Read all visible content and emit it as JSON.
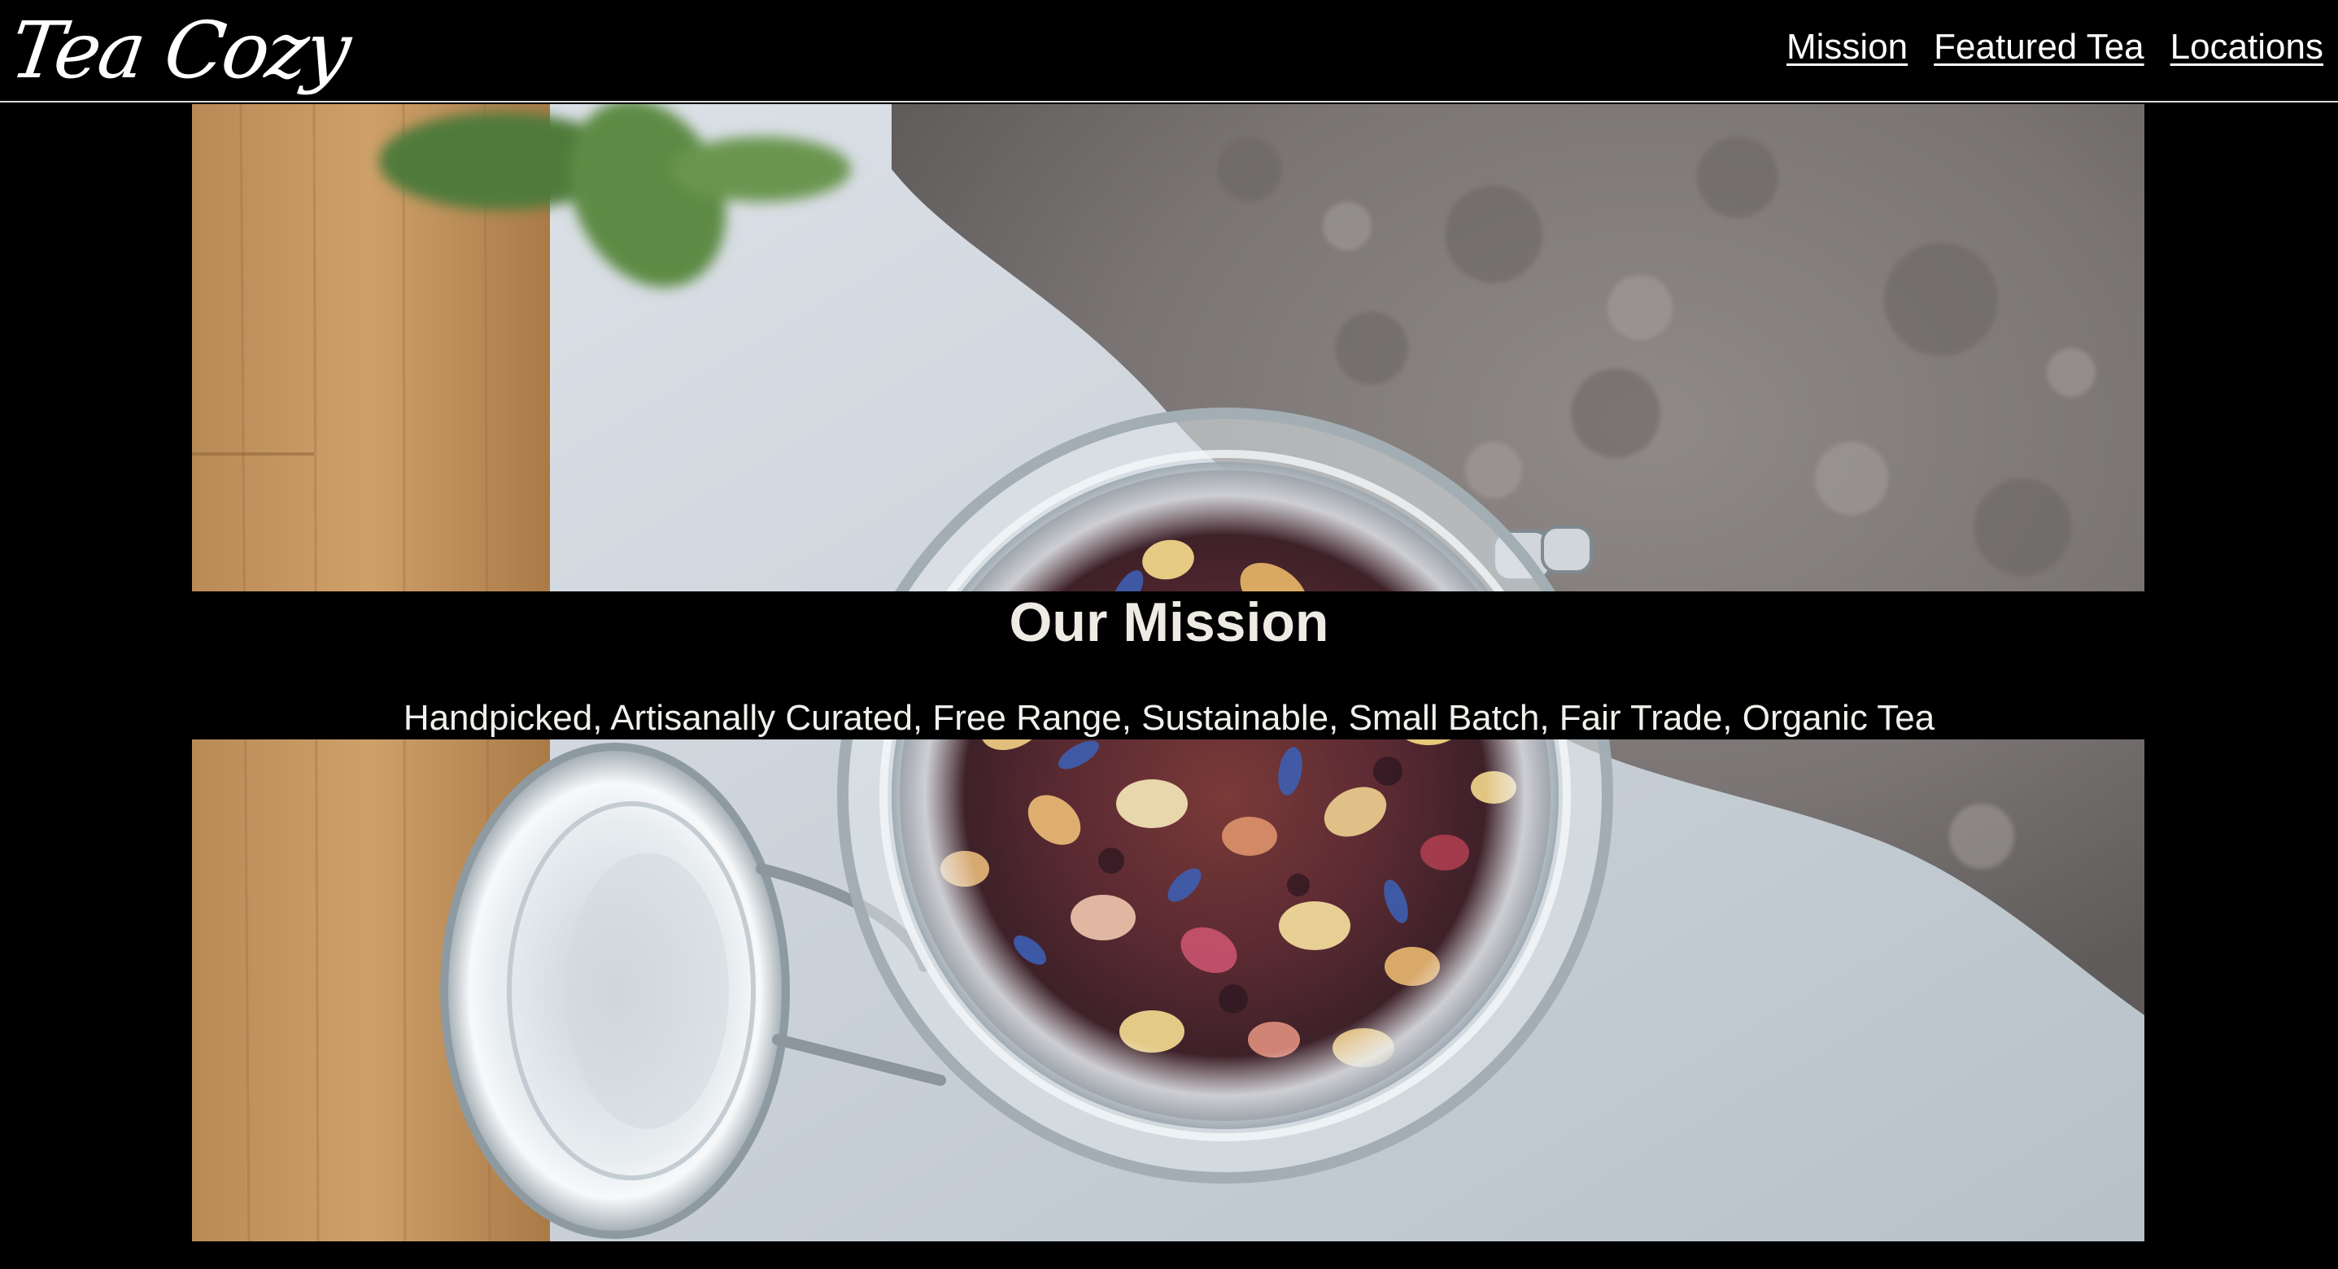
{
  "header": {
    "logo_text": "Tea Cozy",
    "nav": [
      {
        "label": "Mission"
      },
      {
        "label": "Featured Tea"
      },
      {
        "label": "Locations"
      }
    ]
  },
  "hero": {
    "image_subject": "open glass jar of dried floral tea leaves on a wooden board beside a grey towel"
  },
  "mission": {
    "title": "Our Mission",
    "text": "Handpicked, Artisanally Curated, Free Range, Sustainable, Small Batch, Fair Trade, Organic Tea"
  },
  "colors": {
    "background": "#000000",
    "nav_text": "#ffffff",
    "mission_text": "#eeeae4",
    "header_rule": "#d9d9d9"
  }
}
